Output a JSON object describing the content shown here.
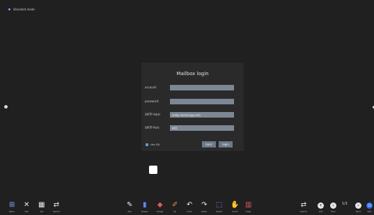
{
  "app": {
    "title": "Standard mode"
  },
  "dialog": {
    "title": "Mailbox login",
    "account_label": "account:",
    "account_value": "",
    "password_label": "password:",
    "password_value": "",
    "smtp_addr_label": "SMTP Addr:",
    "smtp_addr_value": "smtp.exmail.qq.com",
    "smtp_port_label": "SMTP Port:",
    "smtp_port_value": "465",
    "ssl_label": "Use SSL",
    "back_label": "back",
    "login_label": "login"
  },
  "toolbar_left": [
    {
      "label": "Menu",
      "icon": "grid-icon"
    },
    {
      "label": "Tool",
      "icon": "tools-icon"
    },
    {
      "label": "Sel",
      "icon": "select-grid-icon"
    },
    {
      "label": "Switch",
      "icon": "switch-icon"
    }
  ],
  "toolbar_center": [
    {
      "label": "Pen",
      "icon": "pen-icon"
    },
    {
      "label": "Eraser",
      "icon": "eraser-icon"
    },
    {
      "label": "Shape",
      "icon": "shape-icon"
    },
    {
      "label": "Sp",
      "icon": "brush-icon"
    },
    {
      "label": "Undo",
      "icon": "undo-icon"
    },
    {
      "label": "Redo",
      "icon": "redo-icon"
    },
    {
      "label": "Select",
      "icon": "select-icon"
    },
    {
      "label": "Scroll",
      "icon": "hand-icon"
    },
    {
      "label": "Clear",
      "icon": "clear-icon"
    }
  ],
  "toolbar_right": {
    "switch_label": "Switch",
    "add_label": "Add",
    "prev_label": "Prev",
    "next_label": "Next",
    "exit_label": "Exit",
    "page": "1/1"
  }
}
